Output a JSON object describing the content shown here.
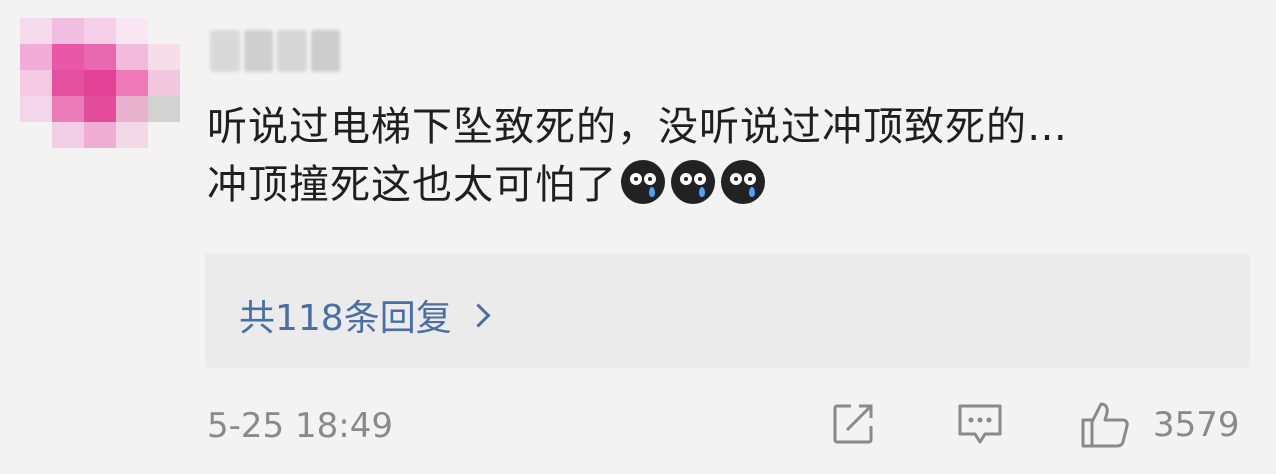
{
  "comment": {
    "line1": "听说过电梯下坠致死的，没听说过冲顶致死的…",
    "line2": "冲顶撞死这也太可怕了",
    "emojis": [
      "crying-emoji",
      "crying-emoji",
      "crying-emoji"
    ]
  },
  "replies": {
    "label": "共118条回复"
  },
  "footer": {
    "timestamp": "5-25 18:49",
    "like_count": "3579"
  },
  "colors": {
    "link": "#4a6fa5",
    "meta": "#8a8a8a",
    "text": "#1f1f1f"
  }
}
